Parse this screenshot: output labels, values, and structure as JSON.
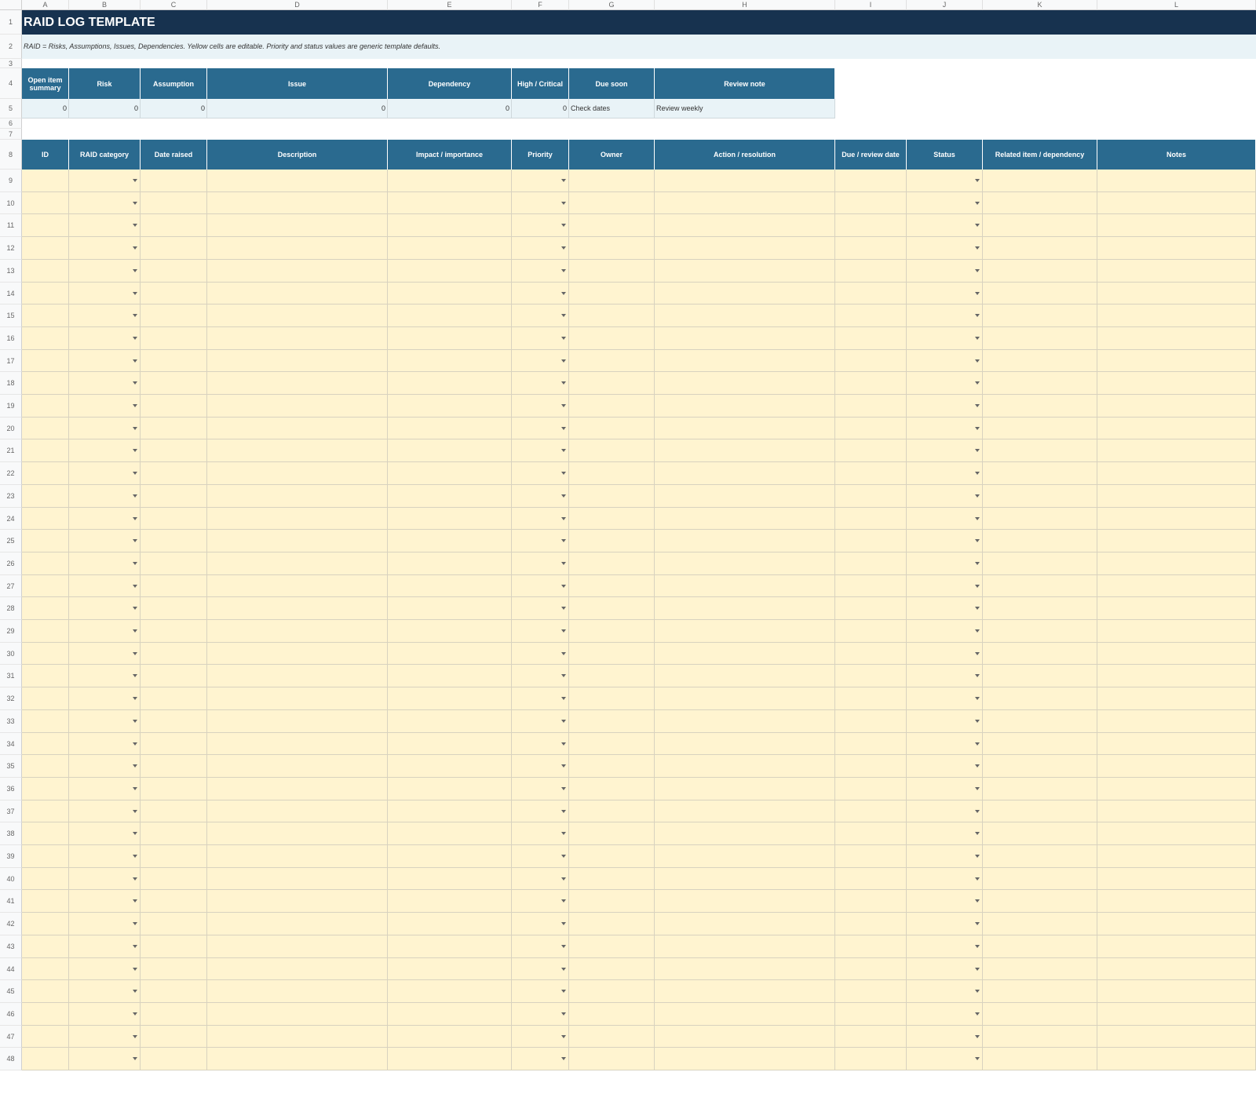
{
  "columns": [
    "A",
    "B",
    "C",
    "D",
    "E",
    "F",
    "G",
    "H",
    "I",
    "J",
    "K",
    "L"
  ],
  "title": "RAID LOG TEMPLATE",
  "subtitle": "RAID = Risks, Assumptions, Issues, Dependencies. Yellow cells are editable. Priority and status values are generic template defaults.",
  "summary": {
    "headers": [
      "Open item summary",
      "Risk",
      "Assumption",
      "Issue",
      "Dependency",
      "High / Critical",
      "Due soon",
      "Review note"
    ],
    "values": [
      "0",
      "0",
      "0",
      "0",
      "0",
      "0",
      "Check dates",
      "Review weekly"
    ]
  },
  "log": {
    "headers": [
      "ID",
      "RAID category",
      "Date raised",
      "Description",
      "Impact / importance",
      "Priority",
      "Owner",
      "Action / resolution",
      "Due / review date",
      "Status",
      "Related item / dependency",
      "Notes"
    ],
    "dropdown_columns": [
      1,
      5,
      9
    ]
  },
  "row_numbers": {
    "top": [
      "1",
      "2",
      "3",
      "4",
      "5",
      "6",
      "7",
      "8"
    ],
    "log": [
      "9",
      "10",
      "11",
      "12",
      "13",
      "14",
      "15",
      "16",
      "17",
      "18",
      "19",
      "20",
      "21",
      "22",
      "23",
      "24",
      "25",
      "26",
      "27",
      "28",
      "29",
      "30",
      "31",
      "32",
      "33",
      "34",
      "35",
      "36",
      "37",
      "38",
      "39",
      "40",
      "41",
      "42",
      "43",
      "44",
      "45",
      "46",
      "47",
      "48"
    ]
  },
  "colors": {
    "title_bg": "#17324f",
    "header_bg": "#2a6a8f",
    "summary_bg": "#e9f3f7",
    "editable_bg": "#fff4d0"
  }
}
